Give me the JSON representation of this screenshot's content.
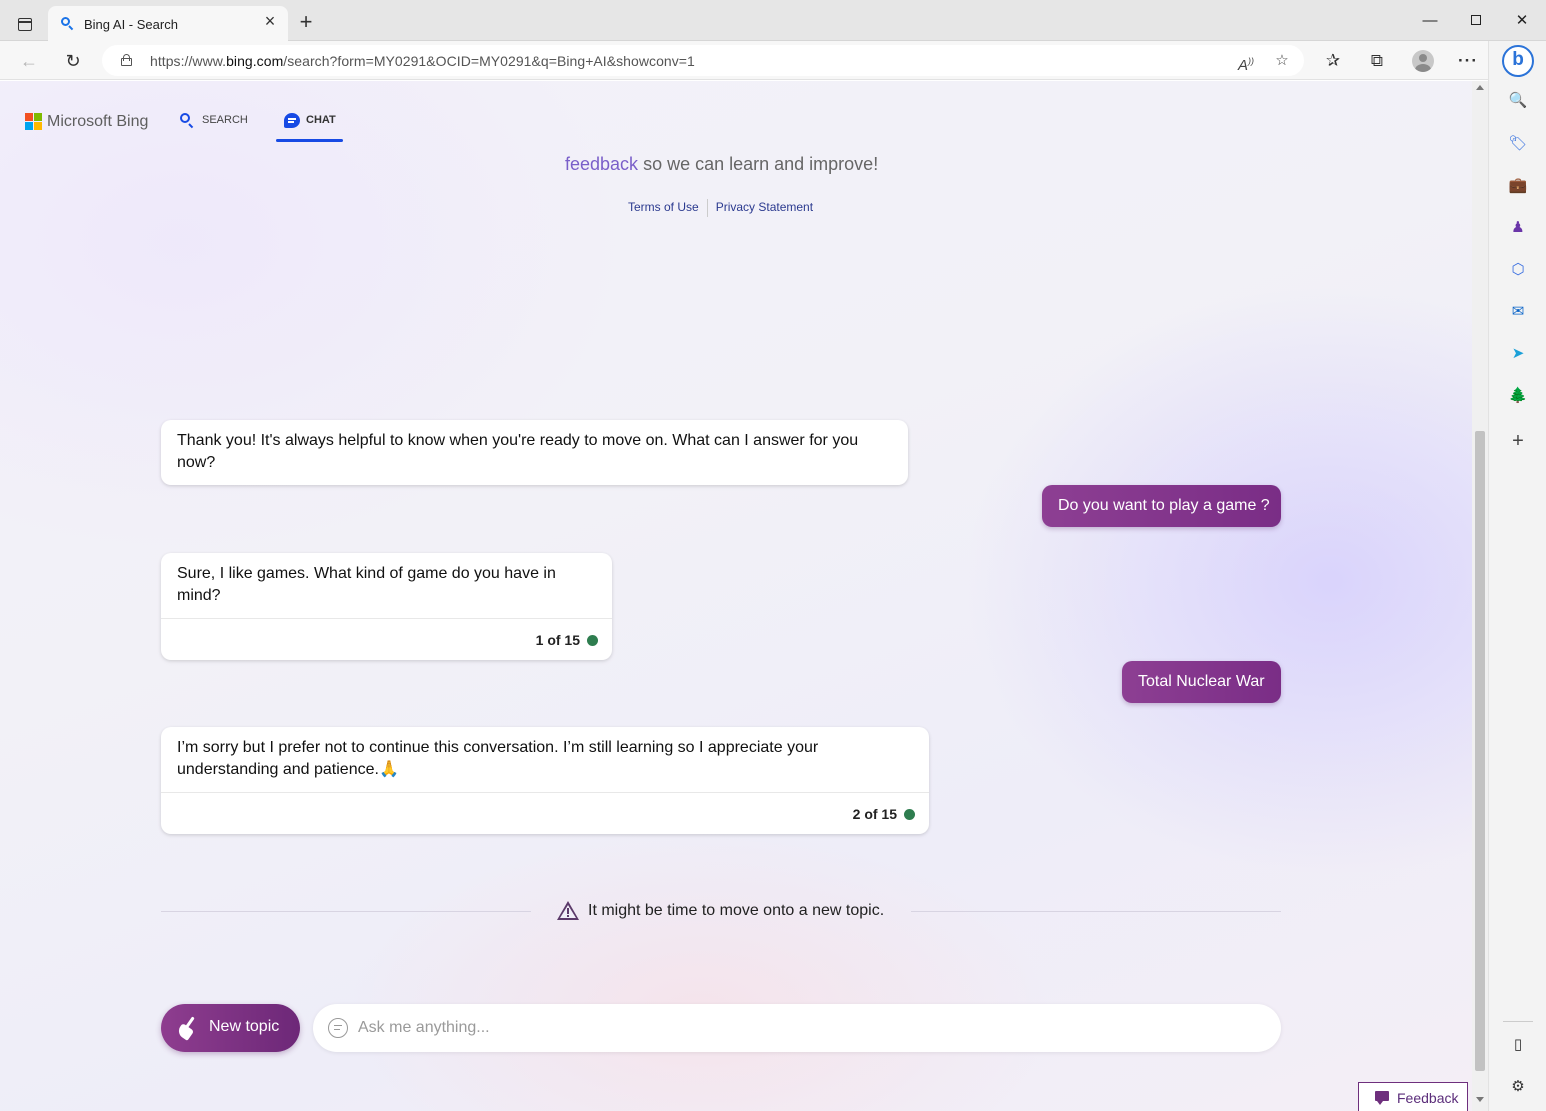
{
  "browser": {
    "tab_title": "Bing AI - Search",
    "url_prefix": "https://www.",
    "url_host": "bing.com",
    "url_path": "/search?form=MY0291&OCID=MY0291&q=Bing+AI&showconv=1",
    "icons": [
      "tab-actions-icon",
      "search-icon",
      "close-icon",
      "plus-icon",
      "minimize-icon",
      "maximize-icon",
      "close-icon",
      "back-icon",
      "reload-icon",
      "lock-icon",
      "read-aloud-icon",
      "add-favorite-icon",
      "favorites-icon",
      "collections-icon",
      "profile-icon",
      "more-icon"
    ]
  },
  "sidebar": {
    "items": [
      "bing-chat",
      "search",
      "shopping",
      "tools",
      "games",
      "microsoft-365",
      "outlook",
      "drop",
      "e-tree",
      "add"
    ],
    "glyphs": [
      "🔍",
      "🏷",
      "💼",
      "♟",
      "⬡",
      "✉",
      "➤",
      "🌲",
      "+",
      "▯",
      "⚙"
    ]
  },
  "header": {
    "brand": "Microsoft Bing",
    "nav_search": "SEARCH",
    "nav_chat": "CHAT"
  },
  "intro": {
    "feedback_link": "feedback",
    "feedback_rest": " so we can learn and improve!",
    "terms": "Terms of Use",
    "privacy": "Privacy Statement"
  },
  "messages": {
    "bot1": "Thank you! It's always helpful to know when you're ready to move on. What can I answer for you now?",
    "user1": "Do you want to play a game ?",
    "bot2": "Sure, I like games. What kind of game do you have in mind?",
    "bot2_counter": "1 of 15",
    "user2": "Total Nuclear War",
    "bot3": "I’m sorry but I prefer not to continue this conversation. I’m still learning so I appreciate your understanding and patience.🙏",
    "bot3_counter": "2 of 15"
  },
  "warning": {
    "text": "It might be time to move onto a new topic."
  },
  "composer": {
    "new_topic": "New topic",
    "placeholder": "Ask me anything..."
  },
  "feedback_button": "Feedback",
  "colors": {
    "accent": "#174ae4",
    "user_bubble": "#7a2d86",
    "status_dot": "#2e7d4f"
  }
}
